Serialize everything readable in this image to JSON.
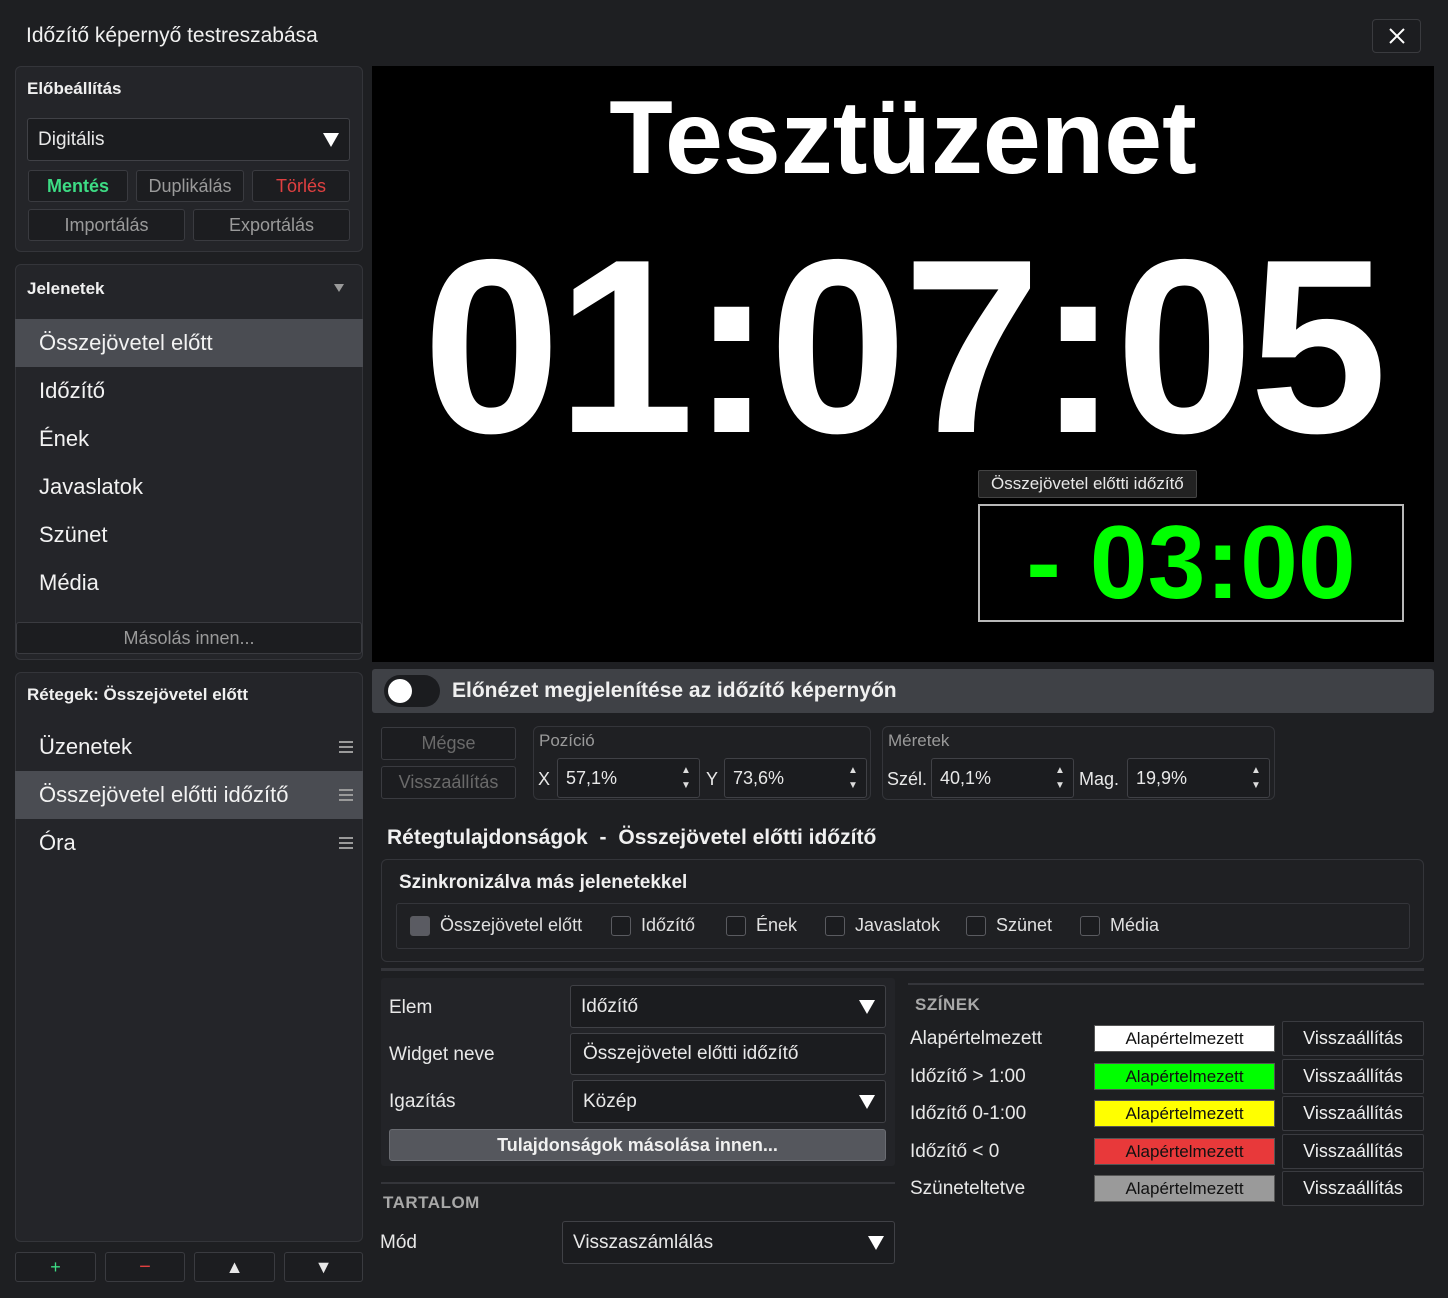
{
  "window": {
    "title": "Időzítő képernyő testreszabása"
  },
  "preset": {
    "header": "Előbeállítás",
    "selected": "Digitális",
    "save": "Mentés",
    "duplicate": "Duplikálás",
    "delete": "Törlés",
    "import": "Importálás",
    "export": "Exportálás"
  },
  "scenes": {
    "header": "Jelenetek",
    "items": [
      "Összejövetel előtt",
      "Időzítő",
      "Ének",
      "Javaslatok",
      "Szünet",
      "Média"
    ],
    "copy_from": "Másolás innen..."
  },
  "layers": {
    "header": "Rétegek: Összejövetel előtt",
    "items": [
      "Üzenetek",
      "Összejövetel előtti időzítő",
      "Óra"
    ],
    "add": "+",
    "remove": "−",
    "up": "▲",
    "down": "▼"
  },
  "preview": {
    "message": "Tesztüzenet",
    "clock": "01:07:05",
    "timer_label": "Összejövetel előtti időzítő",
    "timer": "- 03:00"
  },
  "toggle": {
    "label": "Előnézet megjelenítése az időzítő képernyőn",
    "on": false
  },
  "actions": {
    "cancel": "Mégse",
    "reset": "Visszaállítás"
  },
  "position": {
    "header": "Pozíció",
    "x_label": "X",
    "x": "57,1%",
    "y_label": "Y",
    "y": "73,6%"
  },
  "size": {
    "header": "Méretek",
    "w_label": "Szél.",
    "w": "40,1%",
    "h_label": "Mag.",
    "h": "19,9%"
  },
  "layer_props": {
    "title": "Rétegtulajdonságok",
    "separator": "-",
    "layer_name": "Összejövetel előtti időzítő"
  },
  "sync": {
    "header": "Szinkronizálva más jelenetekkel",
    "scenes": [
      "Összejövetel előtt",
      "Időzítő",
      "Ének",
      "Javaslatok",
      "Szünet",
      "Média"
    ]
  },
  "element": {
    "label": "Elem",
    "value": "Időzítő",
    "widget_label": "Widget neve",
    "widget_value": "Összejövetel előtti időzítő",
    "align_label": "Igazítás",
    "align_value": "Közép",
    "copy_props": "Tulajdonságok másolása innen..."
  },
  "content": {
    "header": "TARTALOM",
    "mode_label": "Mód",
    "mode_value": "Visszaszámlálás"
  },
  "colors": {
    "header": "SZÍNEK",
    "reset_label": "Visszaállítás",
    "rows": [
      {
        "label": "Alapértelmezett",
        "value": "Alapértelmezett",
        "color": "#ffffff"
      },
      {
        "label": "Időzítő > 1:00",
        "value": "Alapértelmezett",
        "color": "#00ff00"
      },
      {
        "label": "Időzítő 0-1:00",
        "value": "Alapértelmezett",
        "color": "#ffff00"
      },
      {
        "label": "Időzítő < 0",
        "value": "Alapértelmezett",
        "color": "#e8393a"
      },
      {
        "label": "Szüneteltetve",
        "value": "Alapértelmezett",
        "color": "#9a9a9a"
      }
    ]
  },
  "theme": {
    "accent_green": "#00ff00",
    "save_green": "#3ddc84",
    "delete_red": "#e04040"
  }
}
